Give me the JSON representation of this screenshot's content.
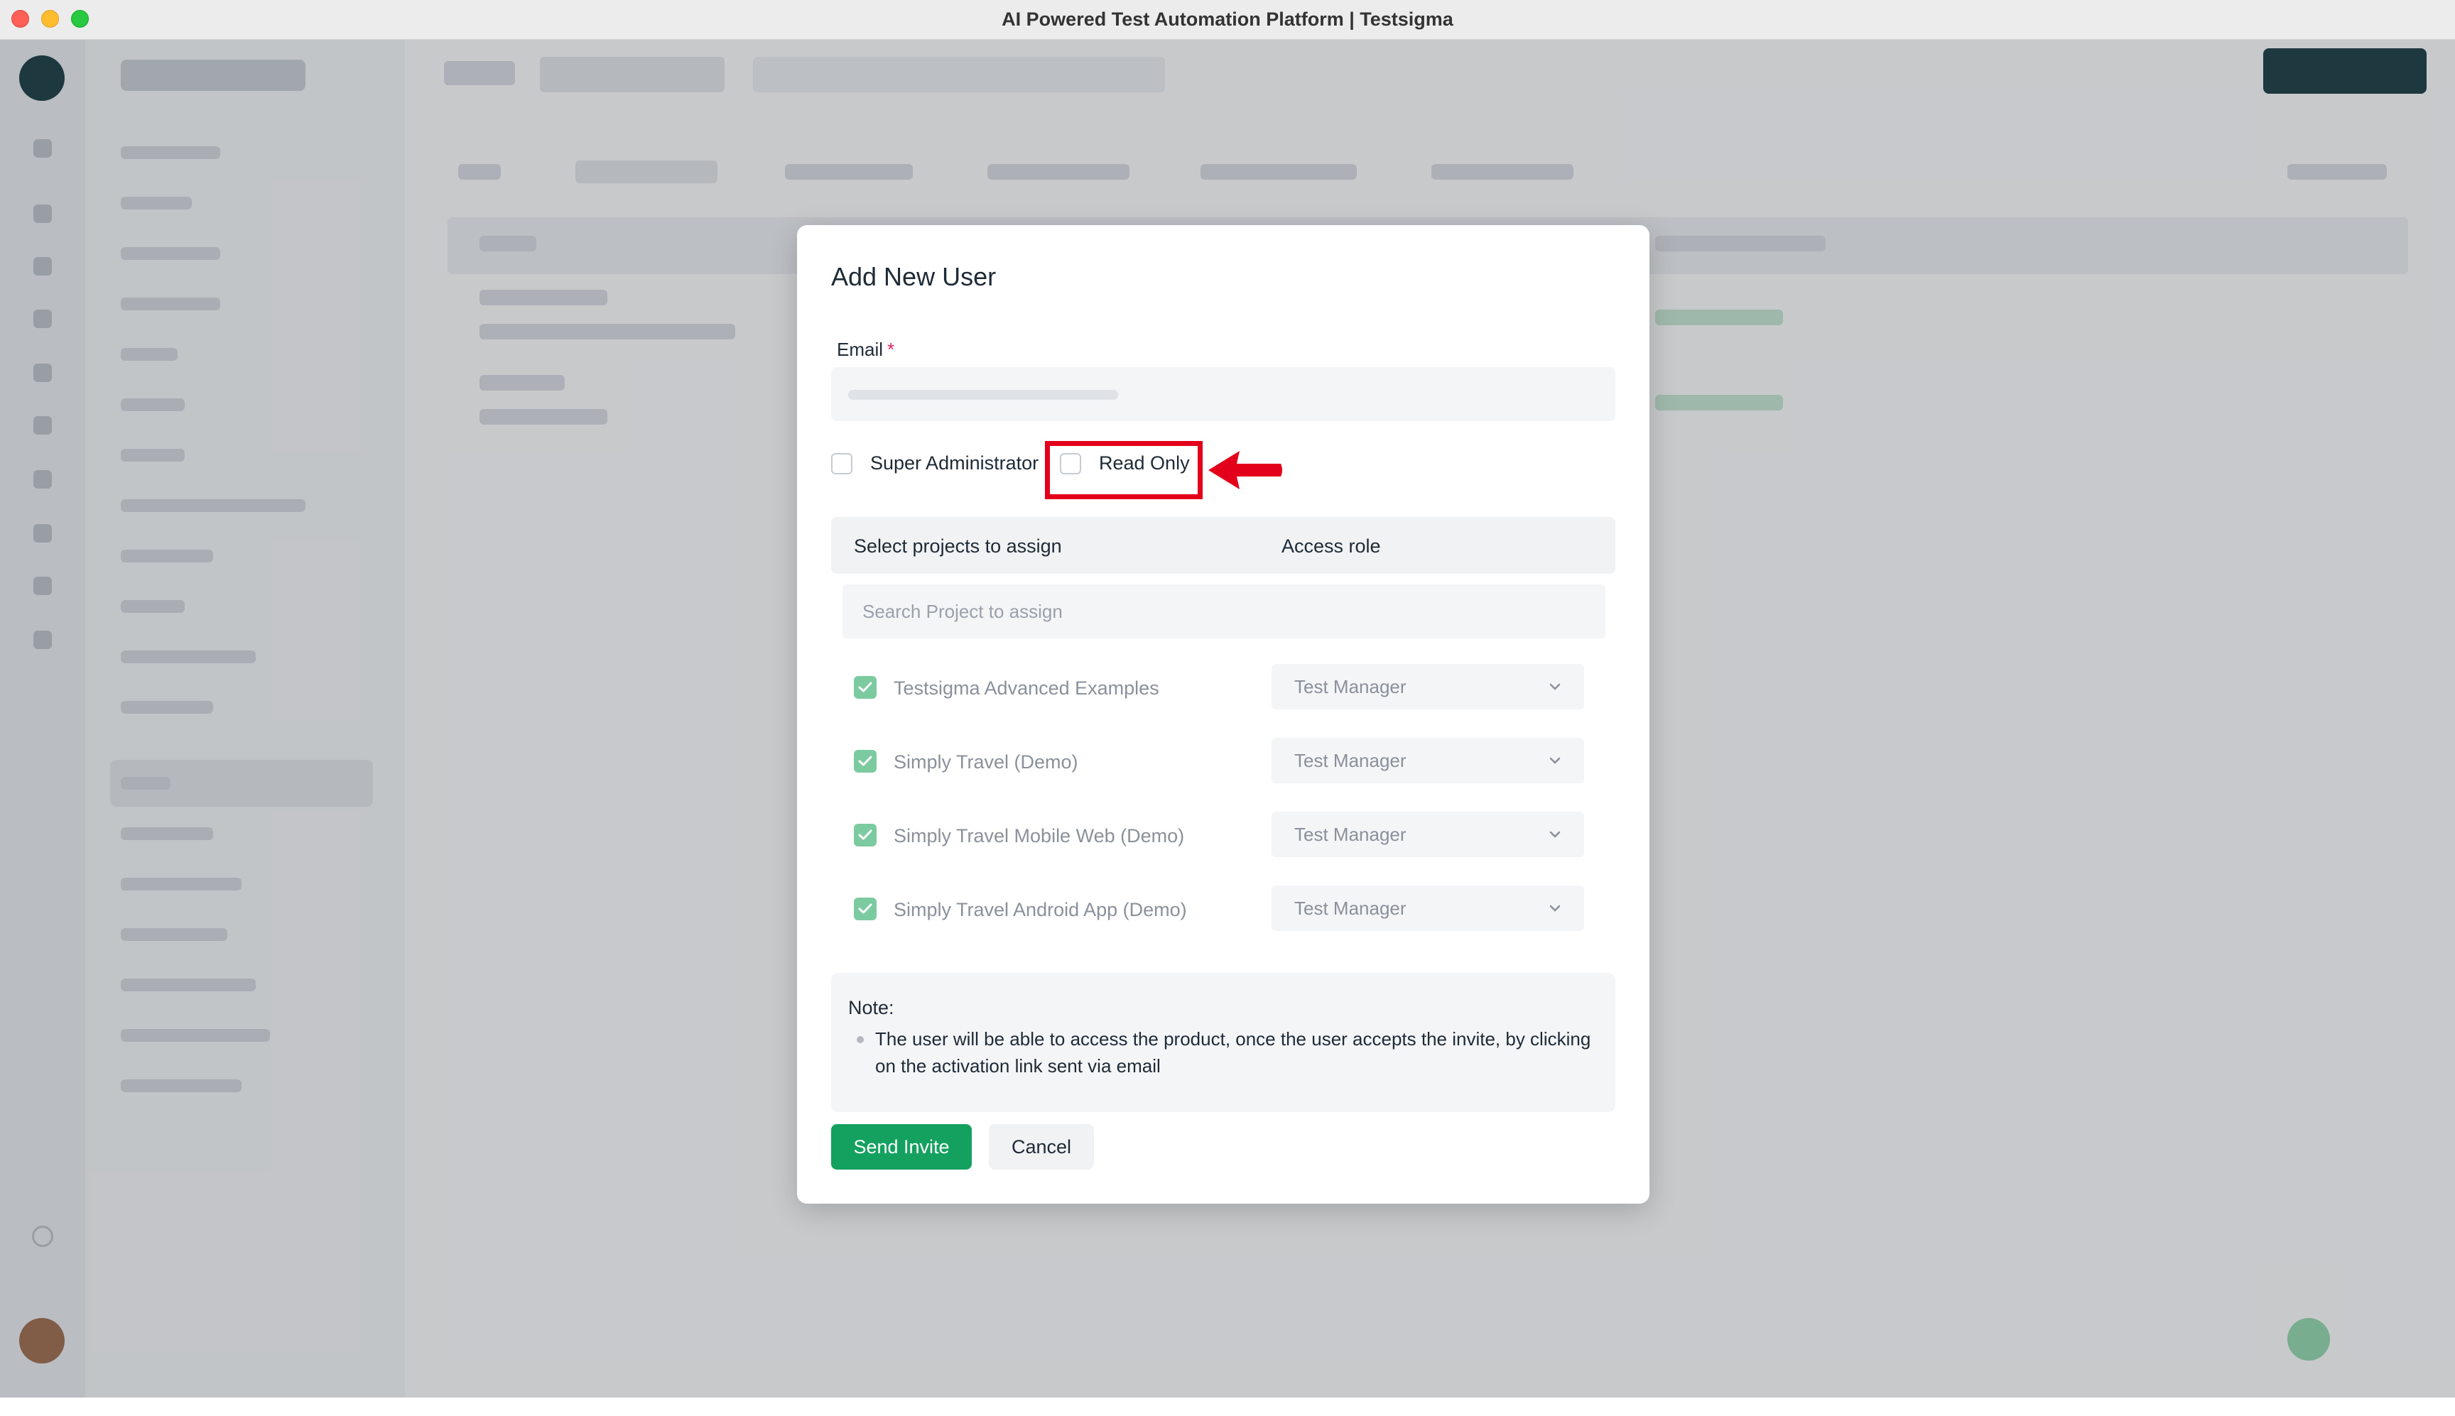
{
  "window": {
    "title": "AI Powered Test Automation Platform | Testsigma"
  },
  "modal": {
    "title": "Add New User",
    "email": {
      "label": "Email",
      "required_mark": "*",
      "value": ""
    },
    "options": {
      "super_admin_label": "Super Administrator",
      "read_only_label": "Read Only",
      "super_admin_checked": false,
      "read_only_checked": false
    },
    "projects_header": {
      "select_label": "Select projects to assign",
      "role_label": "Access role"
    },
    "search": {
      "placeholder": "Search Project to assign"
    },
    "projects": [
      {
        "name": "Testsigma Advanced Examples",
        "role": "Test Manager",
        "checked": true
      },
      {
        "name": "Simply Travel (Demo)",
        "role": "Test Manager",
        "checked": true
      },
      {
        "name": "Simply Travel Mobile Web (Demo)",
        "role": "Test Manager",
        "checked": true
      },
      {
        "name": "Simply Travel Android App (Demo)",
        "role": "Test Manager",
        "checked": true
      }
    ],
    "note": {
      "title": "Note:",
      "body": "The user will be able to access the product, once the user accepts the invite, by clicking on the activation link sent via email"
    },
    "buttons": {
      "send": "Send Invite",
      "cancel": "Cancel"
    }
  },
  "colors": {
    "primary_green": "#14a05f",
    "highlight_red": "#e3001b",
    "brand_dark": "#1c3b45"
  },
  "icons": {
    "checkbox_checked": "check-icon",
    "dropdown": "chevron-down-icon",
    "annotation": "red-arrow-icon"
  }
}
